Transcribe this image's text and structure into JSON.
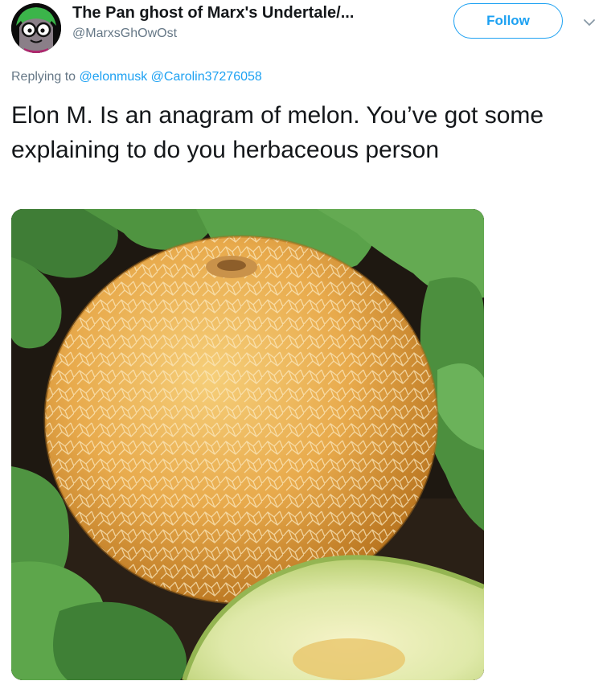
{
  "author": {
    "name": "The Pan ghost of Marx's Undertale/...",
    "handle": "@MarxsGhOwOst",
    "avatar_icon": "cartoon-ghost-with-glasses-avatar"
  },
  "follow": {
    "label": "Follow",
    "color": "#1da1f2"
  },
  "menu": {
    "icon": "chevron-down-icon"
  },
  "reply": {
    "prefix": "Replying to",
    "mentions": [
      "@elonmusk",
      "@Carolin37276058"
    ]
  },
  "tweet": {
    "text": "Elon M. Is an anagram of melon. You’ve got some explaining to do you herbaceous person"
  },
  "media": {
    "subject": "cantaloupe-melon-photo"
  },
  "colors": {
    "text": "#14171a",
    "secondary": "#657786",
    "link": "#1da1f2"
  }
}
